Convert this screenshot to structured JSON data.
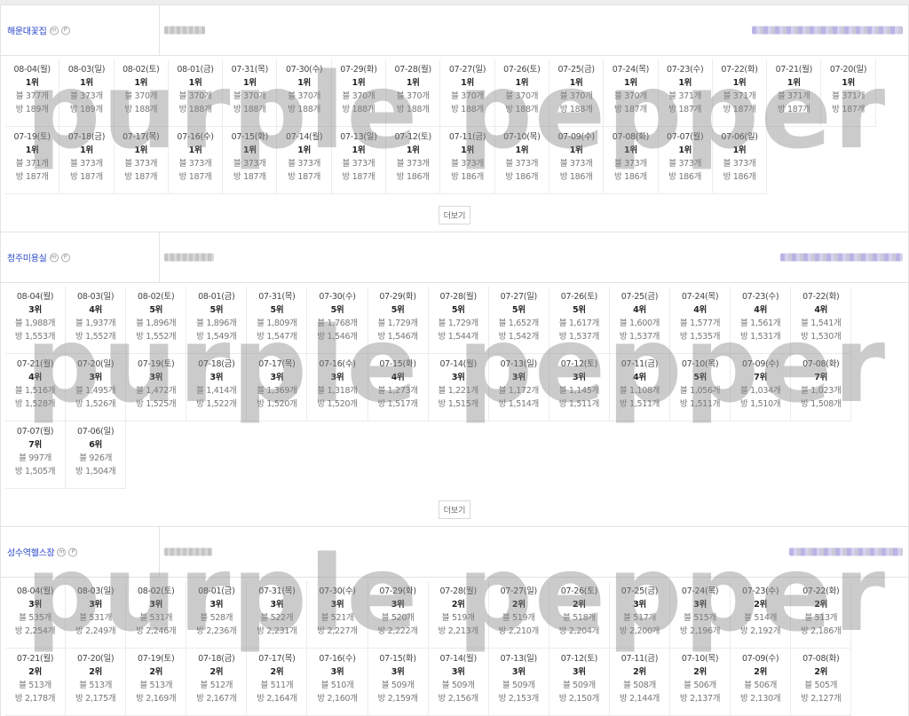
{
  "more_label": "더보기",
  "watermark_text": "purple pepper",
  "sections": [
    {
      "name": "해운대꽃집",
      "cells": [
        {
          "date": "08-04(월)",
          "rank": "1위",
          "a": "블 377개",
          "b": "방 189개"
        },
        {
          "date": "08-03(일)",
          "rank": "1위",
          "a": "블 373개",
          "b": "방 189개"
        },
        {
          "date": "08-02(토)",
          "rank": "1위",
          "a": "블 370개",
          "b": "방 188개"
        },
        {
          "date": "08-01(금)",
          "rank": "1위",
          "a": "블 370개",
          "b": "방 188개"
        },
        {
          "date": "07-31(목)",
          "rank": "1위",
          "a": "블 370개",
          "b": "방 188개"
        },
        {
          "date": "07-30(수)",
          "rank": "1위",
          "a": "블 370개",
          "b": "방 188개"
        },
        {
          "date": "07-29(화)",
          "rank": "1위",
          "a": "블 370개",
          "b": "방 188개"
        },
        {
          "date": "07-28(월)",
          "rank": "1위",
          "a": "블 370개",
          "b": "방 188개"
        },
        {
          "date": "07-27(일)",
          "rank": "1위",
          "a": "블 370개",
          "b": "방 188개"
        },
        {
          "date": "07-26(토)",
          "rank": "1위",
          "a": "블 370개",
          "b": "방 188개"
        },
        {
          "date": "07-25(금)",
          "rank": "1위",
          "a": "블 370개",
          "b": "방 188개"
        },
        {
          "date": "07-24(목)",
          "rank": "1위",
          "a": "블 370개",
          "b": "방 187개"
        },
        {
          "date": "07-23(수)",
          "rank": "1위",
          "a": "블 371개",
          "b": "방 187개"
        },
        {
          "date": "07-22(화)",
          "rank": "1위",
          "a": "블 371개",
          "b": "방 187개"
        },
        {
          "date": "07-21(월)",
          "rank": "1위",
          "a": "블 371개",
          "b": "방 187개"
        },
        {
          "date": "07-20(일)",
          "rank": "1위",
          "a": "블 371개",
          "b": "방 187개"
        },
        {
          "date": "07-19(토)",
          "rank": "1위",
          "a": "블 371개",
          "b": "방 187개"
        },
        {
          "date": "07-18(금)",
          "rank": "1위",
          "a": "블 373개",
          "b": "방 187개"
        },
        {
          "date": "07-17(목)",
          "rank": "1위",
          "a": "블 373개",
          "b": "방 187개"
        },
        {
          "date": "07-16(수)",
          "rank": "1위",
          "a": "블 373개",
          "b": "방 187개"
        },
        {
          "date": "07-15(화)",
          "rank": "1위",
          "a": "블 373개",
          "b": "방 187개"
        },
        {
          "date": "07-14(월)",
          "rank": "1위",
          "a": "블 373개",
          "b": "방 187개"
        },
        {
          "date": "07-13(일)",
          "rank": "1위",
          "a": "블 373개",
          "b": "방 187개"
        },
        {
          "date": "07-12(토)",
          "rank": "1위",
          "a": "블 373개",
          "b": "방 186개"
        },
        {
          "date": "07-11(금)",
          "rank": "1위",
          "a": "블 373개",
          "b": "방 186개"
        },
        {
          "date": "07-10(목)",
          "rank": "1위",
          "a": "블 373개",
          "b": "방 186개"
        },
        {
          "date": "07-09(수)",
          "rank": "1위",
          "a": "블 373개",
          "b": "방 186개"
        },
        {
          "date": "07-08(화)",
          "rank": "1위",
          "a": "블 373개",
          "b": "방 186개"
        },
        {
          "date": "07-07(월)",
          "rank": "1위",
          "a": "블 373개",
          "b": "방 186개"
        },
        {
          "date": "07-06(일)",
          "rank": "1위",
          "a": "블 373개",
          "b": "방 186개"
        }
      ]
    },
    {
      "name": "청주미용실",
      "cells": [
        {
          "date": "08-04(월)",
          "rank": "3위",
          "a": "블 1,988개",
          "b": "방 1,553개"
        },
        {
          "date": "08-03(일)",
          "rank": "4위",
          "a": "블 1,937개",
          "b": "방 1,552개"
        },
        {
          "date": "08-02(토)",
          "rank": "5위",
          "a": "블 1,896개",
          "b": "방 1,552개"
        },
        {
          "date": "08-01(금)",
          "rank": "5위",
          "a": "블 1,896개",
          "b": "방 1,549개"
        },
        {
          "date": "07-31(목)",
          "rank": "5위",
          "a": "블 1,809개",
          "b": "방 1,547개"
        },
        {
          "date": "07-30(수)",
          "rank": "5위",
          "a": "블 1,768개",
          "b": "방 1,546개"
        },
        {
          "date": "07-29(화)",
          "rank": "5위",
          "a": "블 1,729개",
          "b": "방 1,546개"
        },
        {
          "date": "07-28(월)",
          "rank": "5위",
          "a": "블 1,729개",
          "b": "방 1,544개"
        },
        {
          "date": "07-27(일)",
          "rank": "5위",
          "a": "블 1,652개",
          "b": "방 1,542개"
        },
        {
          "date": "07-26(토)",
          "rank": "5위",
          "a": "블 1,617개",
          "b": "방 1,537개"
        },
        {
          "date": "07-25(금)",
          "rank": "4위",
          "a": "블 1,600개",
          "b": "방 1,537개"
        },
        {
          "date": "07-24(목)",
          "rank": "4위",
          "a": "블 1,577개",
          "b": "방 1,535개"
        },
        {
          "date": "07-23(수)",
          "rank": "4위",
          "a": "블 1,561개",
          "b": "방 1,531개"
        },
        {
          "date": "07-22(화)",
          "rank": "4위",
          "a": "블 1,541개",
          "b": "방 1,530개"
        },
        {
          "date": "07-21(월)",
          "rank": "4위",
          "a": "블 1,516개",
          "b": "방 1,528개"
        },
        {
          "date": "07-20(일)",
          "rank": "3위",
          "a": "블 1,495개",
          "b": "방 1,526개"
        },
        {
          "date": "07-19(토)",
          "rank": "3위",
          "a": "블 1,472개",
          "b": "방 1,525개"
        },
        {
          "date": "07-18(금)",
          "rank": "3위",
          "a": "블 1,414개",
          "b": "방 1,522개"
        },
        {
          "date": "07-17(목)",
          "rank": "3위",
          "a": "블 1,369개",
          "b": "방 1,520개"
        },
        {
          "date": "07-16(수)",
          "rank": "3위",
          "a": "블 1,318개",
          "b": "방 1,520개"
        },
        {
          "date": "07-15(화)",
          "rank": "4위",
          "a": "블 1,273개",
          "b": "방 1,517개"
        },
        {
          "date": "07-14(월)",
          "rank": "3위",
          "a": "블 1,221개",
          "b": "방 1,515개"
        },
        {
          "date": "07-13(일)",
          "rank": "3위",
          "a": "블 1,172개",
          "b": "방 1,514개"
        },
        {
          "date": "07-12(토)",
          "rank": "3위",
          "a": "블 1,145개",
          "b": "방 1,511개"
        },
        {
          "date": "07-11(금)",
          "rank": "4위",
          "a": "블 1,108개",
          "b": "방 1,511개"
        },
        {
          "date": "07-10(목)",
          "rank": "5위",
          "a": "블 1,056개",
          "b": "방 1,511개"
        },
        {
          "date": "07-09(수)",
          "rank": "7위",
          "a": "블 1,034개",
          "b": "방 1,510개"
        },
        {
          "date": "07-08(화)",
          "rank": "7위",
          "a": "블 1,023개",
          "b": "방 1,508개"
        },
        {
          "date": "07-07(월)",
          "rank": "7위",
          "a": "블 997개",
          "b": "방 1,505개"
        },
        {
          "date": "07-06(일)",
          "rank": "6위",
          "a": "블 926개",
          "b": "방 1,504개"
        }
      ]
    },
    {
      "name": "성수역헬스장",
      "cells": [
        {
          "date": "08-04(월)",
          "rank": "3위",
          "a": "블 535개",
          "b": "방 2,254개"
        },
        {
          "date": "08-03(일)",
          "rank": "3위",
          "a": "블 531개",
          "b": "방 2,249개"
        },
        {
          "date": "08-02(토)",
          "rank": "3위",
          "a": "블 531개",
          "b": "방 2,246개"
        },
        {
          "date": "08-01(금)",
          "rank": "3위",
          "a": "블 528개",
          "b": "방 2,236개"
        },
        {
          "date": "07-31(목)",
          "rank": "3위",
          "a": "블 522개",
          "b": "방 2,231개"
        },
        {
          "date": "07-30(수)",
          "rank": "3위",
          "a": "블 521개",
          "b": "방 2,227개"
        },
        {
          "date": "07-29(화)",
          "rank": "3위",
          "a": "블 520개",
          "b": "방 2,222개"
        },
        {
          "date": "07-28(월)",
          "rank": "2위",
          "a": "블 519개",
          "b": "방 2,213개"
        },
        {
          "date": "07-27(일)",
          "rank": "2위",
          "a": "블 519개",
          "b": "방 2,210개"
        },
        {
          "date": "07-26(토)",
          "rank": "2위",
          "a": "블 518개",
          "b": "방 2,204개"
        },
        {
          "date": "07-25(금)",
          "rank": "3위",
          "a": "블 517개",
          "b": "방 2,200개"
        },
        {
          "date": "07-24(목)",
          "rank": "3위",
          "a": "블 515개",
          "b": "방 2,196개"
        },
        {
          "date": "07-23(수)",
          "rank": "2위",
          "a": "블 514개",
          "b": "방 2,192개"
        },
        {
          "date": "07-22(화)",
          "rank": "2위",
          "a": "블 513개",
          "b": "방 2,186개"
        },
        {
          "date": "07-21(월)",
          "rank": "2위",
          "a": "블 513개",
          "b": "방 2,178개"
        },
        {
          "date": "07-20(일)",
          "rank": "2위",
          "a": "블 513개",
          "b": "방 2,175개"
        },
        {
          "date": "07-19(토)",
          "rank": "2위",
          "a": "블 513개",
          "b": "방 2,169개"
        },
        {
          "date": "07-18(금)",
          "rank": "2위",
          "a": "블 512개",
          "b": "방 2,167개"
        },
        {
          "date": "07-17(목)",
          "rank": "2위",
          "a": "블 511개",
          "b": "방 2,164개"
        },
        {
          "date": "07-16(수)",
          "rank": "3위",
          "a": "블 510개",
          "b": "방 2,160개"
        },
        {
          "date": "07-15(화)",
          "rank": "3위",
          "a": "블 509개",
          "b": "방 2,159개"
        },
        {
          "date": "07-14(월)",
          "rank": "3위",
          "a": "블 509개",
          "b": "방 2,156개"
        },
        {
          "date": "07-13(일)",
          "rank": "3위",
          "a": "블 509개",
          "b": "방 2,153개"
        },
        {
          "date": "07-12(토)",
          "rank": "3위",
          "a": "블 509개",
          "b": "방 2,150개"
        },
        {
          "date": "07-11(금)",
          "rank": "2위",
          "a": "블 508개",
          "b": "방 2,144개"
        },
        {
          "date": "07-10(목)",
          "rank": "2위",
          "a": "블 506개",
          "b": "방 2,137개"
        },
        {
          "date": "07-09(수)",
          "rank": "2위",
          "a": "블 506개",
          "b": "방 2,130개"
        },
        {
          "date": "07-08(화)",
          "rank": "2위",
          "a": "블 505개",
          "b": "방 2,127개"
        }
      ]
    }
  ]
}
